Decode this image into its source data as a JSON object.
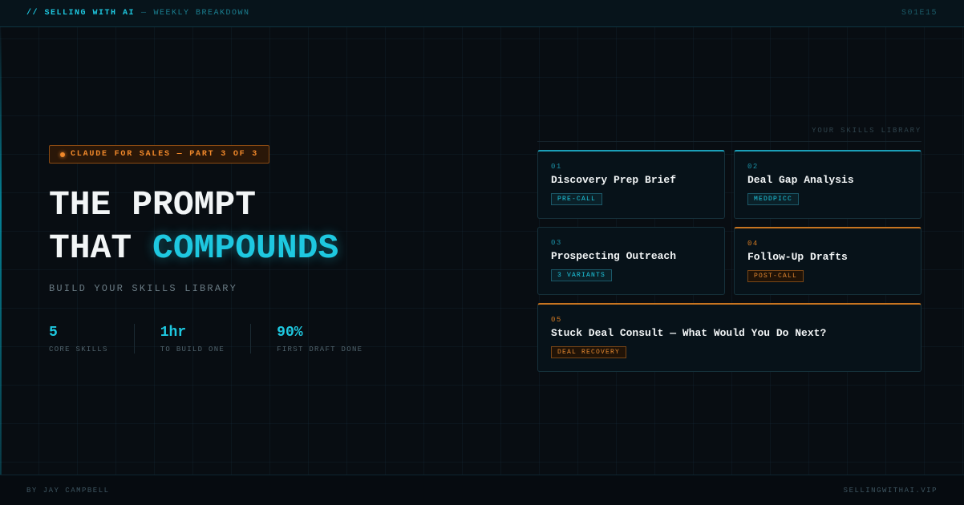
{
  "topbar": {
    "brand": "// SELLING WITH AI",
    "separator": "—",
    "subtitle": "WEEKLY BREAKDOWN",
    "episode": "S01E15"
  },
  "badge": {
    "label": "CLAUDE FOR SALES — PART 3 OF 3",
    "color": "#f0882a"
  },
  "headline": {
    "line1": "THE PROMPT",
    "line2_plain": "THAT",
    "line2_accent": "COMPOUNDS",
    "accent_color": "#1ec8e0"
  },
  "subtitle": "BUILD YOUR SKILLS LIBRARY",
  "stats": [
    {
      "value": "5",
      "label": "CORE SKILLS"
    },
    {
      "value": "1hr",
      "label": "TO BUILD ONE"
    },
    {
      "value": "90%",
      "label": "FIRST DRAFT DONE"
    }
  ],
  "library": {
    "title": "YOUR SKILLS LIBRARY",
    "cards": [
      {
        "index": "01",
        "title": "Discovery Prep Brief",
        "tag": "PRE-CALL",
        "accent": "cyan"
      },
      {
        "index": "02",
        "title": "Deal Gap Analysis",
        "tag": "MEDDPICC",
        "accent": "cyan"
      },
      {
        "index": "03",
        "title": "Prospecting Outreach",
        "tag": "3 VARIANTS",
        "accent": "cyan"
      },
      {
        "index": "04",
        "title": "Follow-Up Drafts",
        "tag": "POST-CALL",
        "accent": "orange"
      },
      {
        "index": "05",
        "title": "Stuck Deal Consult — What Would You Do Next?",
        "tag": "DEAL RECOVERY",
        "accent": "orange"
      }
    ]
  },
  "footer": {
    "author": "BY JAY CAMPBELL",
    "site": "SELLINGWITHAI.VIP"
  }
}
